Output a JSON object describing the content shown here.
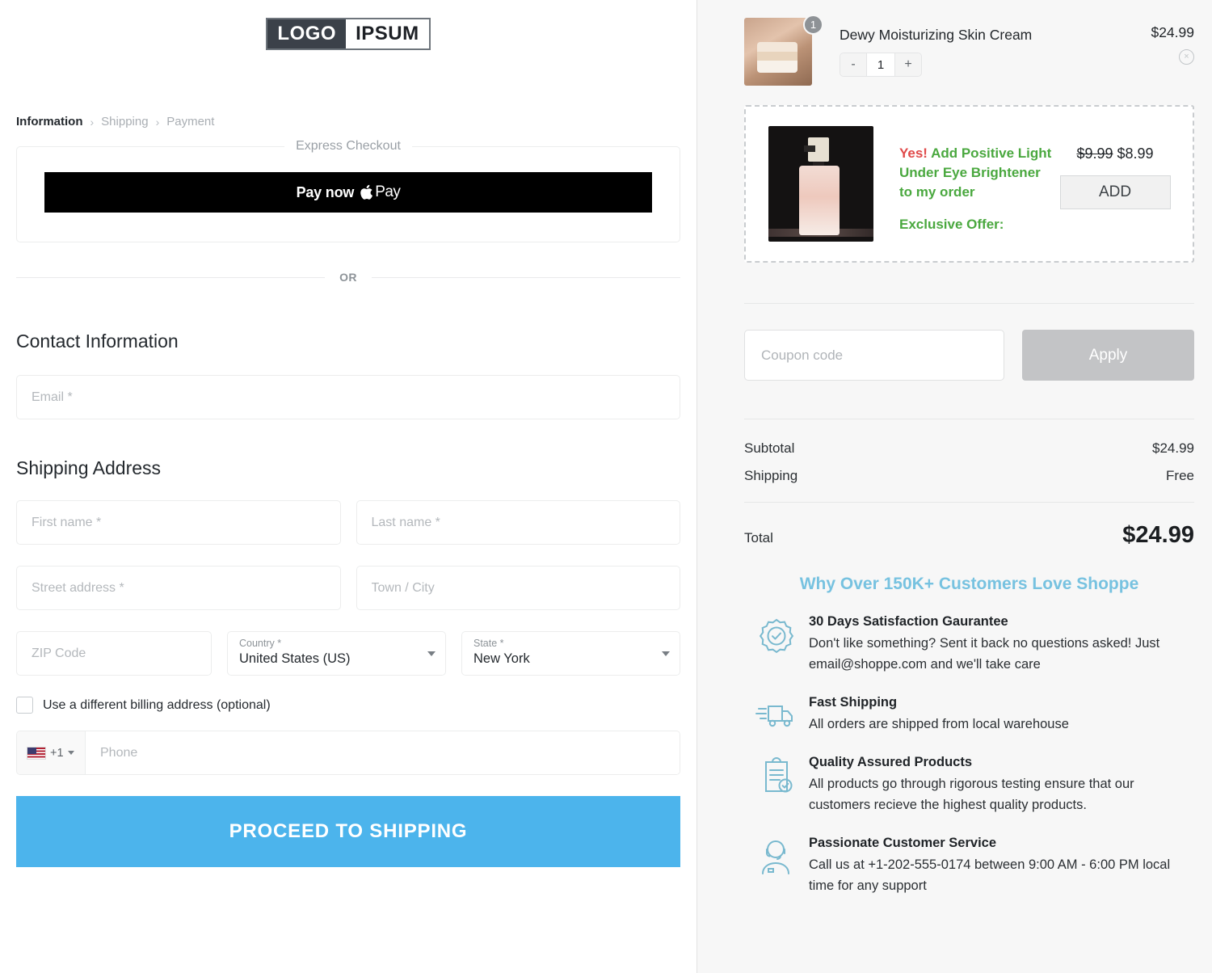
{
  "brand": {
    "logo_dark": "LOGO",
    "logo_light": "IPSUM"
  },
  "breadcrumb": {
    "steps": [
      {
        "label": "Information",
        "state": "active"
      },
      {
        "label": "Shipping",
        "state": "inactive"
      },
      {
        "label": "Payment",
        "state": "inactive"
      }
    ],
    "separator": "›"
  },
  "express": {
    "legend": "Express Checkout",
    "apple_pay_text": "Pay now",
    "apple_pay_brand": "Pay",
    "apple_icon": "apple-logo-icon"
  },
  "or_divider": {
    "text": "OR"
  },
  "contact": {
    "title": "Contact Information",
    "email_placeholder": "Email *"
  },
  "shipping": {
    "title": "Shipping Address",
    "first_name_placeholder": "First name *",
    "last_name_placeholder": "Last name *",
    "street_placeholder": "Street address *",
    "city_placeholder": "Town / City",
    "zip_placeholder": "ZIP Code",
    "country_label": "Country *",
    "country_value": "United States (US)",
    "state_label": "State *",
    "state_value": "New York",
    "billing_checkbox_label": "Use a different billing address (optional)",
    "billing_checked": false,
    "phone_country_code": "+1",
    "phone_flag": "us-flag-icon",
    "phone_placeholder": "Phone",
    "proceed_label": "PROCEED TO SHIPPING"
  },
  "cart": {
    "item": {
      "name": "Dewy Moisturizing Skin Cream",
      "price": "$24.99",
      "quantity_badge": "1",
      "quantity": "1",
      "decrement": "-",
      "increment": "+",
      "remove_icon": "×",
      "thumbnail": "product-thumbnail-skin-cream"
    }
  },
  "upsell": {
    "yes": "Yes!",
    "headline": "Add Positive Light Under Eye Brightener to my order",
    "exclusive": "Exclusive Offer:",
    "old_price": "$9.99",
    "new_price": "$8.99",
    "add_label": "ADD",
    "image": "positive-light-under-eye-brightener-image"
  },
  "coupon": {
    "placeholder": "Coupon code",
    "value": "",
    "apply_label": "Apply"
  },
  "totals": {
    "rows": [
      {
        "label": "Subtotal",
        "value": "$24.99"
      },
      {
        "label": "Shipping",
        "value": "Free"
      }
    ],
    "grand_label": "Total",
    "grand_value": "$24.99"
  },
  "trust": {
    "heading": "Why Over 150K+ Customers Love Shoppe",
    "badges": [
      {
        "icon": "ribbon-check-icon",
        "title": "30 Days Satisfaction Gaurantee",
        "desc": "Don't like something? Sent it back no questions asked! Just email@shoppe.com and we'll take care"
      },
      {
        "icon": "delivery-truck-icon",
        "title": "Fast Shipping",
        "desc": "All orders are shipped from local warehouse"
      },
      {
        "icon": "clipboard-check-icon",
        "title": "Quality Assured Products",
        "desc": "All products go through rigorous testing ensure that our customers recieve the highest quality products."
      },
      {
        "icon": "headset-agent-icon",
        "title": "Passionate Customer Service",
        "desc": "Call us at +1-202-555-0174 between 9:00 AM - 6:00 PM local time for any support"
      }
    ]
  },
  "colors": {
    "accent_blue": "#4cb4ec",
    "trust_heading_blue": "#77c2e0",
    "offer_green": "#4aa83f",
    "offer_red": "#e04a4a",
    "panel_bg": "#f7f7f7"
  }
}
